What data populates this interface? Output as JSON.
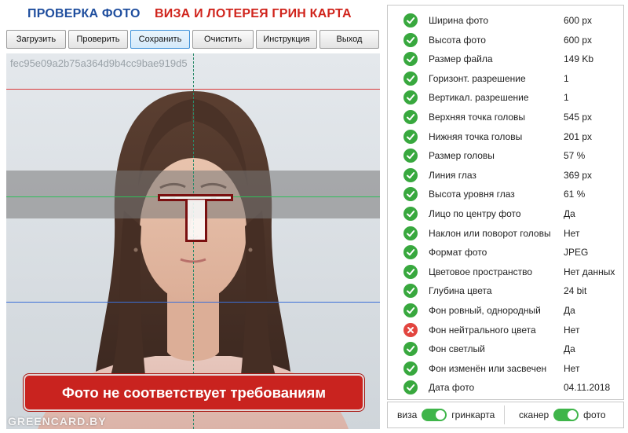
{
  "header": {
    "title_left": "ПРОВЕРКА ФОТО",
    "title_right": "ВИЗА И ЛОТЕРЕЯ ГРИН КАРТА"
  },
  "toolbar": {
    "buttons": [
      {
        "label": "Загрузить"
      },
      {
        "label": "Проверить"
      },
      {
        "label": "Сохранить",
        "active": true
      },
      {
        "label": "Очистить"
      },
      {
        "label": "Инструкция"
      },
      {
        "label": "Выход"
      }
    ]
  },
  "photo": {
    "hash": "fec95e09a2b75a364d9b4cc9bae919d5",
    "warning": "Фото не соответствует требованиям",
    "watermark": "GREENCARD.BY",
    "guide_colors": {
      "top": "#d93c3c",
      "eyes": "#2fbf5a",
      "bottom": "#3b6fd8",
      "center": "#2a8a6a"
    }
  },
  "results": [
    {
      "label": "Ширина фото",
      "value": "600 px",
      "status": "ok"
    },
    {
      "label": "Высота фото",
      "value": "600 px",
      "status": "ok"
    },
    {
      "label": "Размер файла",
      "value": "149 Kb",
      "status": "ok"
    },
    {
      "label": "Горизонт. разрешение",
      "value": "1",
      "status": "ok"
    },
    {
      "label": "Вертикал. разрешение",
      "value": "1",
      "status": "ok"
    },
    {
      "label": "Верхняя точка головы",
      "value": "545 px",
      "status": "ok"
    },
    {
      "label": "Нижняя точка головы",
      "value": "201 px",
      "status": "ok"
    },
    {
      "label": "Размер головы",
      "value": "57 %",
      "status": "ok"
    },
    {
      "label": "Линия глаз",
      "value": "369 px",
      "status": "ok"
    },
    {
      "label": "Высота уровня глаз",
      "value": "61 %",
      "status": "ok"
    },
    {
      "label": "Лицо по центру фото",
      "value": "Да",
      "status": "ok"
    },
    {
      "label": "Наклон или поворот головы",
      "value": "Нет",
      "status": "ok"
    },
    {
      "label": "Формат фото",
      "value": "JPEG",
      "status": "ok"
    },
    {
      "label": "Цветовое пространство",
      "value": "Нет данных",
      "status": "ok"
    },
    {
      "label": "Глубина цвета",
      "value": "24 bit",
      "status": "ok"
    },
    {
      "label": "Фон ровный, однородный",
      "value": "Да",
      "status": "ok"
    },
    {
      "label": "Фон нейтрального цвета",
      "value": "Нет",
      "status": "fail"
    },
    {
      "label": "Фон светлый",
      "value": "Да",
      "status": "ok"
    },
    {
      "label": "Фон изменён или засвечен",
      "value": "Нет",
      "status": "ok"
    },
    {
      "label": "Дата фото",
      "value": "04.11.2018",
      "status": "ok"
    }
  ],
  "toggles": {
    "left": {
      "off_label": "виза",
      "on_label": "гринкарта",
      "on": true
    },
    "right": {
      "off_label": "сканер",
      "on_label": "фото",
      "on": true
    }
  },
  "colors": {
    "ok": "#38a83e",
    "fail": "#e2453f",
    "accent_blue": "#1f4e9e",
    "accent_red": "#d0241c",
    "switch_on": "#3fb54a"
  }
}
